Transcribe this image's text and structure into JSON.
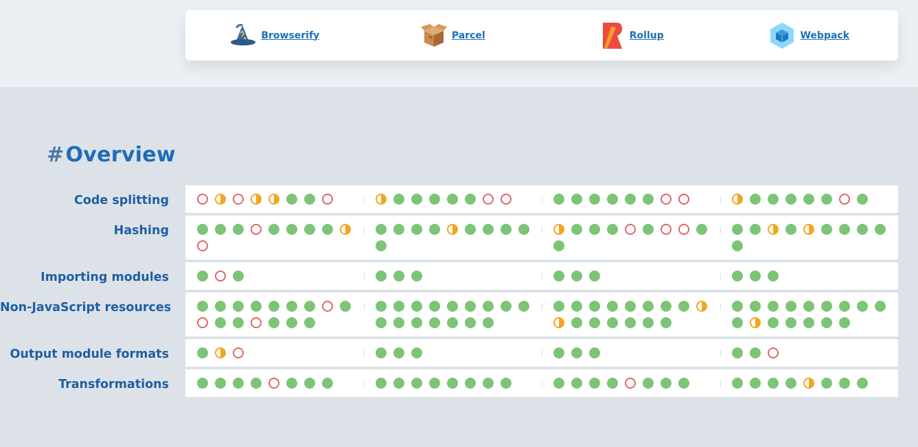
{
  "tools": [
    {
      "name": "Browserify",
      "icon": "wizard-hat-icon"
    },
    {
      "name": "Parcel",
      "icon": "box-icon"
    },
    {
      "name": "Rollup",
      "icon": "rollup-logo-icon"
    },
    {
      "name": "Webpack",
      "icon": "cube-icon"
    }
  ],
  "section": {
    "hash": "#",
    "title": "Overview"
  },
  "colors": {
    "full": "#7cc576",
    "partial": "#f2a620",
    "none": "#e06565",
    "link": "#1d6fb8"
  },
  "rows": [
    {
      "label": "Code splitting",
      "cells": [
        [
          "none",
          "partial",
          "none",
          "partial",
          "partial",
          "full",
          "full",
          "none"
        ],
        [
          "partial",
          "full",
          "full",
          "full",
          "full",
          "full",
          "none",
          "none"
        ],
        [
          "full",
          "full",
          "full",
          "full",
          "full",
          "full",
          "none",
          "none"
        ],
        [
          "partial",
          "full",
          "full",
          "full",
          "full",
          "full",
          "none",
          "full"
        ]
      ]
    },
    {
      "label": "Hashing",
      "cells": [
        [
          "full",
          "full",
          "full",
          "none",
          "full",
          "full",
          "full",
          "full",
          "partial",
          "none"
        ],
        [
          "full",
          "full",
          "full",
          "full",
          "partial",
          "full",
          "full",
          "full",
          "full",
          "full"
        ],
        [
          "partial",
          "full",
          "full",
          "full",
          "none",
          "full",
          "none",
          "none",
          "full",
          "full"
        ],
        [
          "full",
          "full",
          "partial",
          "full",
          "partial",
          "full",
          "full",
          "full",
          "full",
          "full"
        ]
      ]
    },
    {
      "label": "Importing modules",
      "cells": [
        [
          "full",
          "none",
          "full"
        ],
        [
          "full",
          "full",
          "full"
        ],
        [
          "full",
          "full",
          "full"
        ],
        [
          "full",
          "full",
          "full"
        ]
      ]
    },
    {
      "label": "Non-JavaScript resources",
      "cells": [
        [
          "full",
          "full",
          "full",
          "full",
          "full",
          "full",
          "full",
          "none",
          "full",
          "none",
          "full",
          "full",
          "none",
          "full",
          "full",
          "full"
        ],
        [
          "full",
          "full",
          "full",
          "full",
          "full",
          "full",
          "full",
          "full",
          "full",
          "full",
          "full",
          "full",
          "full",
          "full",
          "full",
          "full"
        ],
        [
          "full",
          "full",
          "full",
          "full",
          "full",
          "full",
          "full",
          "full",
          "partial",
          "partial",
          "full",
          "full",
          "full",
          "full",
          "full",
          "full"
        ],
        [
          "full",
          "full",
          "full",
          "full",
          "full",
          "full",
          "full",
          "full",
          "full",
          "full",
          "partial",
          "full",
          "full",
          "full",
          "full",
          "full"
        ]
      ]
    },
    {
      "label": "Output module formats",
      "cells": [
        [
          "full",
          "partial",
          "none"
        ],
        [
          "full",
          "full",
          "full"
        ],
        [
          "full",
          "full",
          "full"
        ],
        [
          "full",
          "full",
          "none"
        ]
      ]
    },
    {
      "label": "Transformations",
      "cells": [
        [
          "full",
          "full",
          "full",
          "full",
          "none",
          "full",
          "full",
          "full"
        ],
        [
          "full",
          "full",
          "full",
          "full",
          "full",
          "full",
          "full",
          "full"
        ],
        [
          "full",
          "full",
          "full",
          "full",
          "none",
          "full",
          "full",
          "full"
        ],
        [
          "full",
          "full",
          "full",
          "full",
          "partial",
          "full",
          "full",
          "full"
        ]
      ]
    }
  ]
}
